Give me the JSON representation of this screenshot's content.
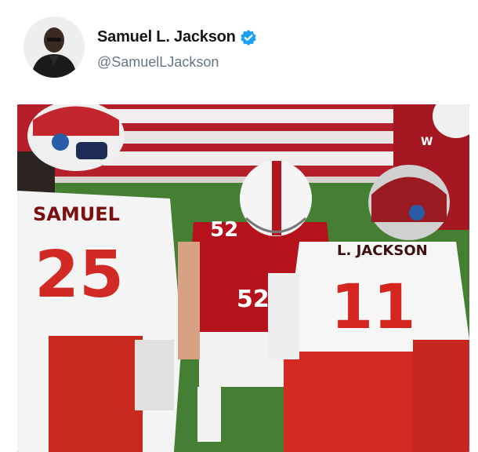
{
  "tweet": {
    "author": {
      "display_name": "Samuel L. Jackson",
      "handle": "@SamuelLJackson",
      "verified": true,
      "avatar_icon": "person-portrait-icon"
    },
    "media": {
      "jersey_left_name": "SAMUEL",
      "jersey_left_number": "25",
      "jersey_center_number": "52",
      "jersey_center_number_lower": "52",
      "jersey_right_name": "L. JACKSON",
      "jersey_right_number": "11",
      "helmet_logo": "W"
    }
  },
  "colors": {
    "verified_blue": "#1da1f2",
    "name_text": "#14171a",
    "handle_text": "#657786",
    "home_red": "#b5121b",
    "away_white": "#f4f4f4",
    "field_green": "#3f7a2e"
  }
}
